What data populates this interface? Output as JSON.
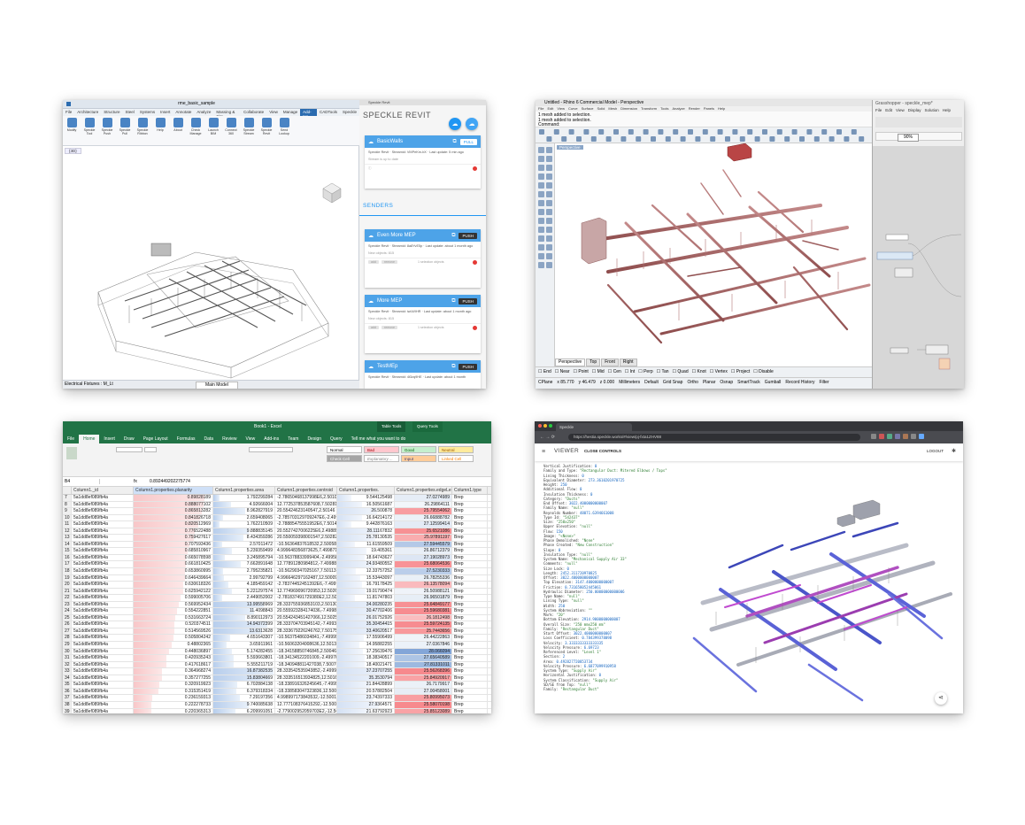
{
  "revit": {
    "title": "rme_basic_sample",
    "tabs": [
      "File",
      "Architecture",
      "Structure",
      "Steel",
      "Systems",
      "Insert",
      "Annotate",
      "Analyze",
      "Massing & Site",
      "Collaborate",
      "View",
      "Manage",
      "Add-Ins",
      "CADTools",
      "Speckle"
    ],
    "ribbon": [
      "Modify",
      "Speckle Tool",
      "Speckle Push",
      "Speckle Pull",
      "Speckle Ribbon",
      "Help",
      "About",
      "Check Manage",
      "Launch BIM",
      "Connect 360",
      "Speckle Stream",
      "Speckle Revit",
      "Send Lookup"
    ],
    "view_tab": "{3D}",
    "speckle_header": "Speckle Revit",
    "speckle_title": "SPECKLE REVIT",
    "receiver": {
      "name": "BasicWalls",
      "action": "PULL",
      "meta": "Speckle Revit · Streamid: VMPeKm-bX · Last update: 5 min ago",
      "note": "Stream is up to date"
    },
    "senders_label": "SENDERS",
    "senders": [
      {
        "name": "Even More MEP",
        "action": "PUSH",
        "meta": "Speckle Revit · Streamid: 8a8YvE5p · Last update: about 1 month ago",
        "note": "New objects: 815",
        "chip": "1 selection objects"
      },
      {
        "name": "More MEP",
        "action": "PUSH",
        "meta": "Speckle Revit · Streamid: iwLWIHR · Last update: about 1 month ago",
        "note": "New objects: 815",
        "chip": "1 selection objects"
      },
      {
        "name": "TestMEp",
        "action": "PUSH",
        "meta": "Speckle Revit · Streamid: 4t3zq9HE · Last update: about 1 month"
      }
    ],
    "status_left": "Electrical Fixtures : M_Lt",
    "status_right": "Main Model"
  },
  "rhino": {
    "title": "Untitled - Rhino 6 Commercial Model - Perspective",
    "menu": [
      "File",
      "Edit",
      "View",
      "Curve",
      "Surface",
      "Solid",
      "Mesh",
      "Dimension",
      "Transform",
      "Tools",
      "Analyze",
      "Render",
      "Panels",
      "Help"
    ],
    "command_lines": [
      "1 mesh added to selection.",
      "1 mesh added to selection.",
      "Command:"
    ],
    "viewport_label": "Perspective",
    "viewport_tabs": [
      "Perspective",
      "Top",
      "Front",
      "Right"
    ],
    "osnap": [
      "End",
      "Near",
      "Point",
      "Mid",
      "Cen",
      "Int",
      "Perp",
      "Tan",
      "Quad",
      "Knot",
      "Vertex",
      "Project",
      "Disable"
    ],
    "status": [
      "CPlane",
      "x 85.770",
      "y 46.479",
      "z 0.000",
      "Millimeters",
      "Default",
      "Grid Snap",
      "Ortho",
      "Planar",
      "Osnap",
      "SmartTrack",
      "Gumball",
      "Record History",
      "Filter"
    ],
    "gh_title": "Grasshopper - speckle_mep*",
    "gh_menu": [
      "File",
      "Edit",
      "View",
      "Display",
      "Solution",
      "Help"
    ],
    "gh_zoom": "90%"
  },
  "excel": {
    "title": "Book1 - Excel",
    "context_tab": "Table Tools",
    "context_tab2": "Query Tools",
    "tabs": [
      "File",
      "Home",
      "Insert",
      "Draw",
      "Page Layout",
      "Formulas",
      "Data",
      "Review",
      "View",
      "Add-ins",
      "Team",
      "Design",
      "Query"
    ],
    "tell_me": "Tell me what you want to do",
    "cell_ref": "B4",
    "formula": "0.892449202275774",
    "styles": [
      "Normal",
      "Bad",
      "Good",
      "Neutral",
      "Check Cell",
      "Explanatory ...",
      "Input",
      "Linked Cell"
    ],
    "columns": [
      "Column1._id",
      "Column1.properties.planarity",
      "Column1.properties.area",
      "Column1.properties.centroid",
      "Column1.properties.",
      "Column1.properties.edgeLength",
      "Column1.type"
    ],
    "rows": [
      [
        7,
        "5a1dd8ef089fb4a",
        "0.89828189",
        "1.792299284",
        "-2.78650468137998E6,2.50102",
        "9.544125498",
        "27.0274989",
        "Brep"
      ],
      [
        8,
        "5a1dd8ef089fb4a",
        "0.888077102",
        "4.92666004",
        "12.772537853587608,7.50281(",
        "16.50561687",
        "26.29864111",
        "Brep"
      ],
      [
        9,
        "5a1dd8ef089fb4a",
        "0.865813282",
        "8.962827919",
        "20.55424623140547,2.50146",
        "26.500878",
        "25.79554062",
        "Brep"
      ],
      [
        10,
        "5a1dd8ef089fb4a",
        "0.841826718",
        "2.659408065",
        "-2.785703129709247E6,-2.4999(",
        "16.64214172",
        "26.66888782",
        "Brep"
      ],
      [
        11,
        "5a1dd8ef089fb4a",
        "0.820512969",
        "1.762210509",
        "-2.78885475551952E6,7.50140",
        "9.442876163",
        "27.12599414",
        "Brep"
      ],
      [
        12,
        "5a1dd8ef089fb4a",
        "0.776522488",
        "9.888835145",
        "20.5527427006225E6,2.49889",
        "28.11167832",
        "25.6521086",
        "Brep"
      ],
      [
        13,
        "5a1dd8ef089fb4a",
        "0.759427617",
        "8.434359286",
        "20.550059398001547,2.50282",
        "25.78130535",
        "25.97891197",
        "Brep"
      ],
      [
        14,
        "5a1dd8ef089fb4a",
        "0.707593436",
        "2.57011472",
        "-10.56364837618532,2.500586",
        "11.61559509",
        "27.59445579",
        "Brep"
      ],
      [
        15,
        "5a1dd8ef089fb4a",
        "0.685810967",
        "5.239359499",
        "4.999648356873625,7.499871",
        "19.405361",
        "26.86712379",
        "Brep"
      ],
      [
        16,
        "5a1dd8ef089fb4a",
        "0.665078598",
        "3.245895794",
        "-10.56378833999404,-2.499589",
        "18.64743627",
        "27.19028973",
        "Brep"
      ],
      [
        17,
        "5a1dd8ef089fb4a",
        "0.661810425",
        "7.662891648",
        "12.77891280984812,-7.499889",
        "24.93480552",
        "25.68064536",
        "Brep"
      ],
      [
        18,
        "5a1dd8ef089fb4a",
        "0.653860995",
        "2.795235821",
        "-10.56290347025167,7.50113",
        "12.33757252",
        "27.5230333",
        "Brep"
      ],
      [
        19,
        "5a1dd8ef089fb4a",
        "0.646439664",
        "2.99792799",
        "4.996646297162487,12.500098",
        "15.53443097",
        "26.78255336",
        "Brep"
      ],
      [
        20,
        "5a1dd8ef089fb4a",
        "0.630618326",
        "4.185459142",
        "-2.78374452451392E6,-7.4999(",
        "16.79178425",
        "26.13578094",
        "Brep"
      ],
      [
        21,
        "5a1dd8ef089fb4a",
        "0.625942122",
        "5.221297574",
        "12.774969096720953,12.50268",
        "19.01790474",
        "26.50988121",
        "Brep"
      ],
      [
        22,
        "5a1dd8ef089fb4a",
        "0.599005706",
        "2.449052002",
        "-2.781837491729380E2,12.50",
        "11.81747803",
        "26.96501879",
        "Brep"
      ],
      [
        23,
        "5a1dd8ef089fb4a",
        "0.569952434",
        "13.99558969",
        "28.333755936853103,2.50130",
        "34.00280235",
        "25.64849177",
        "Brep"
      ],
      [
        24,
        "5a1dd8ef089fb4a",
        "0.554222851",
        "11.4098843",
        "20.555923284174036,-7.49986",
        "30.47702406",
        "25.59680381",
        "Brep"
      ],
      [
        25,
        "5a1dd8ef089fb4a",
        "0.531663724",
        "8.890112973",
        "20.554243451427066,12.5025",
        "26.01752926",
        "26.1812498",
        "Brep"
      ],
      [
        26,
        "5a1dd8ef089fb4a",
        "0.520374511",
        "14.94372399",
        "28.333704703945142,-7.499378",
        "35.30454415",
        "25.59724135",
        "Brep"
      ],
      [
        27,
        "5a1dd8ef089fb4a",
        "0.514569526",
        "13.6313628",
        "28.333679226246762,7.501757",
        "33.40620517",
        "25.7443656",
        "Brep"
      ],
      [
        28,
        "5a1dd8ef089fb4a",
        "0.505804242",
        "4.651643307",
        "-10.56375486034841,-7.49999",
        "17.55906499",
        "26.44222863",
        "Brep"
      ],
      [
        29,
        "5a1dd8ef089fb4a",
        "0.48802365",
        "3.65911961",
        "-10.56063204008636,12.5013",
        "14.95882255",
        "27.0367846",
        "Brep"
      ],
      [
        30,
        "5a1dd8ef089fb4a",
        "0.448036897",
        "5.174282455",
        "-18.34158850746845,2.500465",
        "17.25639476",
        "28.066094",
        "Brep"
      ],
      [
        31,
        "5a1dd8ef089fb4a",
        "0.420935243",
        "5.593663801",
        "-18.34134522201009,-2.49976",
        "18.38340517",
        "27.65640589",
        "Brep"
      ],
      [
        32,
        "5a1dd8ef089fb4a",
        "0.417618617",
        "5.555211719",
        "-18.340948811427038,7.500700",
        "18.40021471",
        "27.81331011",
        "Brep"
      ],
      [
        33,
        "5a1dd8ef089fb4a",
        "0.364968274",
        "16.87382535",
        "28.333542535943852,-2.499965",
        "37.23707255",
        "25.56268396",
        "Brep"
      ],
      [
        34,
        "5a1dd8ef089fb4a",
        "0.357277255",
        "15.83804669",
        "28.333516513934825,12.50162",
        "35.3530794",
        "25.84920917",
        "Brep"
      ],
      [
        35,
        "5a1dd8ef089fb4a",
        "0.320919923",
        "6.702884138",
        "-18.338916326245645,-7.49996",
        "21.84428899",
        "26.7179917",
        "Brep"
      ],
      [
        36,
        "5a1dd8ef089fb4a",
        "0.315351419",
        "6.379318334",
        "-18.338583047323836,12.5004",
        "20.57882504",
        "27.00458001",
        "Brep"
      ],
      [
        37,
        "5a1dd8ef089fb4a",
        "0.236159313",
        "7.29197356",
        "4.998997173843532,-12.50013",
        "23.74397333",
        "25.80995073",
        "Brep"
      ],
      [
        38,
        "5a1dd8ef089fb4a",
        "0.222278733",
        "9.740085638",
        "12.777108376415292,-12.5001",
        "27.9364571",
        "25.58070198",
        "Brep"
      ],
      [
        39,
        "5a1dd8ef089fb4a",
        "0.220365313",
        "6.209991051",
        "-2.779002952059703E2,-12.500",
        "21.63792923",
        "25.85123089",
        "Brep"
      ]
    ]
  },
  "speckle_web": {
    "tab_title": "Speckle",
    "url": "https://hestia.speckle.works/#/view/pj-fxta1ZHV88",
    "viewer": "VIEWER",
    "close_controls": "CLOSE CONTROLS",
    "logout": "LOGOUT",
    "props": [
      [
        "Vertical Justification",
        "0"
      ],
      [
        "Family and Type",
        "\"Rectangular Duct: Mitered Elbows / Taps\""
      ],
      [
        "Lining Thickness",
        "0"
      ],
      [
        "Equivalent Diameter",
        "273.3610201970725"
      ],
      [
        "Height",
        "250"
      ],
      [
        "Additional Flow",
        "0"
      ],
      [
        "Insulation Thickness",
        "0"
      ],
      [
        "Category",
        "\"Ducts\""
      ],
      [
        "End Offset",
        "3022.4000000000007"
      ],
      [
        "Family Name",
        "\"null\""
      ],
      [
        "Reynolds Number",
        "48071.6394661008"
      ],
      [
        "Type Id",
        "\"542437\""
      ],
      [
        "Size",
        "\"250x250\""
      ],
      [
        "Upper Elevation",
        "\"null\""
      ],
      [
        "Flow",
        "150"
      ],
      [
        "Image",
        "\"<None>\""
      ],
      [
        "Phase Demolished",
        "\"None\""
      ],
      [
        "Phase Created",
        "\"New Construction\""
      ],
      [
        "Slope",
        "0"
      ],
      [
        "Insulation Type",
        "\"null\""
      ],
      [
        "System Name",
        "\"Mechanical Supply Air 33\""
      ],
      [
        "Comments",
        "\"null\""
      ],
      [
        "Size Lock",
        "0"
      ],
      [
        "Length",
        "2452.311720970825"
      ],
      [
        "Offset",
        "3022.4000000000007"
      ],
      [
        "Top Elevation",
        "3147.4000000000007"
      ],
      [
        "Friction",
        "0.731658052445061"
      ],
      [
        "Hydraulic Diameter",
        "250.00000000000006"
      ],
      [
        "Type Name",
        "\"null\""
      ],
      [
        "Lining Type",
        "\"null\""
      ],
      [
        "Width",
        "250"
      ],
      [
        "System Abbreviation",
        "\"\""
      ],
      [
        "Mark",
        "\"20\""
      ],
      [
        "Bottom Elevation",
        "2914.9000000000007"
      ],
      [
        "Overall Size",
        "\"250 mmx250 mm\""
      ],
      [
        "Family",
        "\"Rectangular Duct\""
      ],
      [
        "Start Offset",
        "3022.4000000000007"
      ],
      [
        "Loss Coefficient",
        "0.784399378098"
      ],
      [
        "Velocity",
        "3.3333333333333335"
      ],
      [
        "Velocity Pressure",
        "6.69723"
      ],
      [
        "Referenced Level",
        "\"Level 1\""
      ],
      [
        "Section",
        "2"
      ],
      [
        "Area",
        "0.492827720853734"
      ],
      [
        "Velocity Pressure",
        "6.6877099910958"
      ],
      [
        "System Type",
        "\"Supply Air\""
      ],
      [
        "Horizontal Justification",
        "0"
      ],
      [
        "System Classification",
        "\"Supply Air\""
      ],
      [
        "SD/SE from Top",
        "\"null\""
      ],
      [
        "Family",
        "\"Rectangular Duct\""
      ]
    ]
  }
}
